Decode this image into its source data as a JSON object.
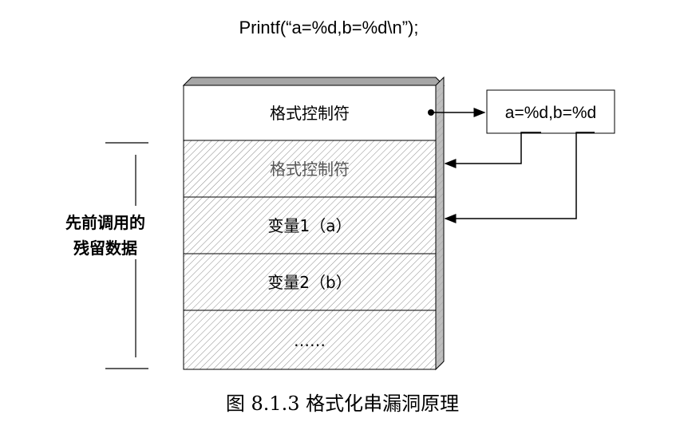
{
  "code_line": "Printf(“a=%d,b=%d\\n”);",
  "stack": {
    "top_cell": "格式控制符",
    "cells": [
      "格式控制符",
      "变量1（a）",
      "变量2（b）",
      "……"
    ]
  },
  "format_box": "a=%d,b=%d",
  "side_label": [
    "先前调用的",
    "残留数据"
  ],
  "caption": "图 8.1.3    格式化串漏洞原理",
  "colors": {
    "hatch": "#8c8c8c",
    "shade": "#a6a6a6",
    "stroke": "#000000"
  }
}
